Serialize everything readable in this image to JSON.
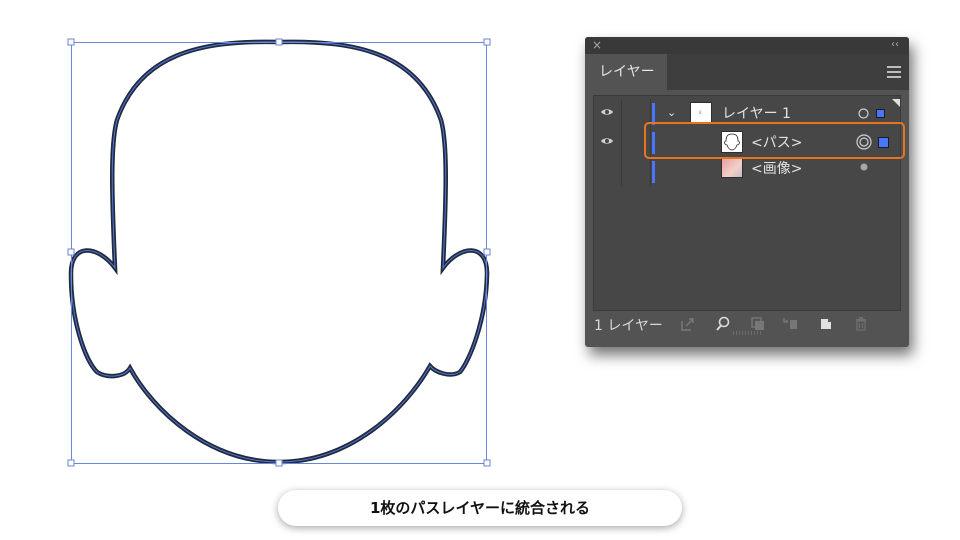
{
  "layers_panel": {
    "tab_label": "レイヤー",
    "close_glyph": "×",
    "collapse_glyph": "‹‹",
    "rows": [
      {
        "label": "レイヤー 1",
        "expanded": true,
        "visible": true
      },
      {
        "label": "<パス>",
        "visible": true,
        "targeted": true,
        "selected": true
      },
      {
        "label": "<画像>",
        "visible": false
      }
    ],
    "footer_count": "1 レイヤー",
    "layer_color": "#4a76ff"
  },
  "highlight_color": "#e8741e",
  "caption": "1枚のパスレイヤーに統合される",
  "icons": [
    "eye-icon",
    "chevron-down-icon",
    "panel-menu-icon",
    "export-icon",
    "search-icon",
    "clipping-mask-icon",
    "move-to-layer-icon",
    "new-layer-icon",
    "trash-icon"
  ]
}
